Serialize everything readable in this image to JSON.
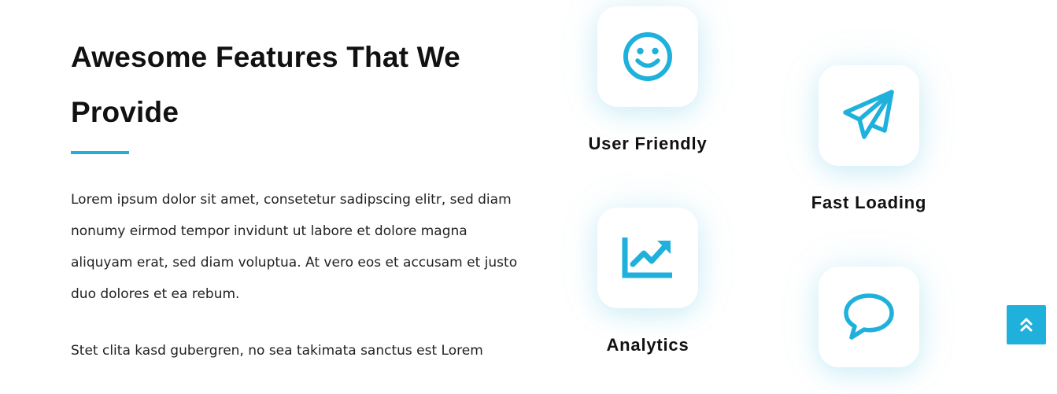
{
  "colors": {
    "accent": "#1fb1dc",
    "heading": "#111111",
    "body_text": "#222222",
    "background": "#ffffff"
  },
  "section": {
    "title_line_1": "Awesome Features That We",
    "title_line_2": "Provide",
    "paragraph_1": "Lorem ipsum dolor sit amet, consetetur sadipscing elitr, sed diam nonumy eirmod tempor invidunt ut labore et dolore magna aliquyam erat, sed diam voluptua. At vero eos et accusam et justo duo dolores et ea rebum.",
    "paragraph_2": "Stet clita kasd gubergren, no sea takimata sanctus est Lorem"
  },
  "features": [
    {
      "label": "User Friendly",
      "icon": "smiley-face-icon"
    },
    {
      "label": "Fast Loading",
      "icon": "paper-plane-icon"
    },
    {
      "label": "Analytics",
      "icon": "trend-chart-icon"
    },
    {
      "label": "",
      "icon": "chat-bubble-icon"
    }
  ],
  "back_to_top": {
    "icon": "double-chevron-up-icon"
  }
}
